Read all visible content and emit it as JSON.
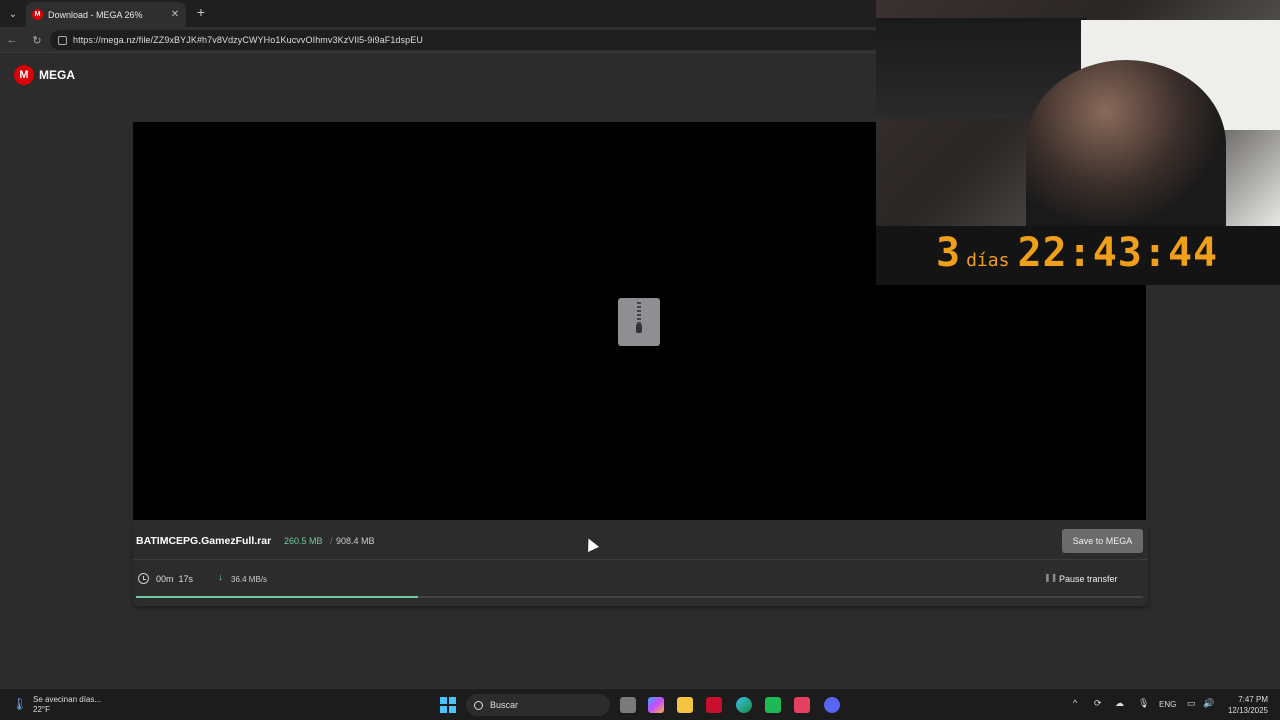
{
  "browser": {
    "tab_title": "Download - MEGA 26%",
    "url": "https://mega.nz/file/ZZ9xBYJK#h7v8VdzyCWYHo1KucvvOIhmv3KzVIl5-9i9aF1dspEU"
  },
  "mega": {
    "logo_text": "MEGA",
    "file_name": "BATIMCEPG.GamezFull.rar",
    "downloaded": "260.5 MB",
    "separator": "/",
    "total_size": "908.4 MB",
    "save_label": "Save to MEGA",
    "time_remaining": "00m  17s",
    "speed": "36.4 MB/s",
    "pause_label": "Pause transfer",
    "progress_percent": 28
  },
  "overlay": {
    "days_number": "3",
    "days_label": "días",
    "time": "22:43:44"
  },
  "taskbar": {
    "weather_line1": "Se avecinan días...",
    "weather_line2": "22°F",
    "search_placeholder": "Buscar",
    "language": "ENG",
    "time": "7:47 PM",
    "date": "12/13/2025"
  },
  "colors": {
    "mega_red": "#d90007",
    "progress_green": "#6ec9a0",
    "countdown_orange": "#f0a018"
  }
}
